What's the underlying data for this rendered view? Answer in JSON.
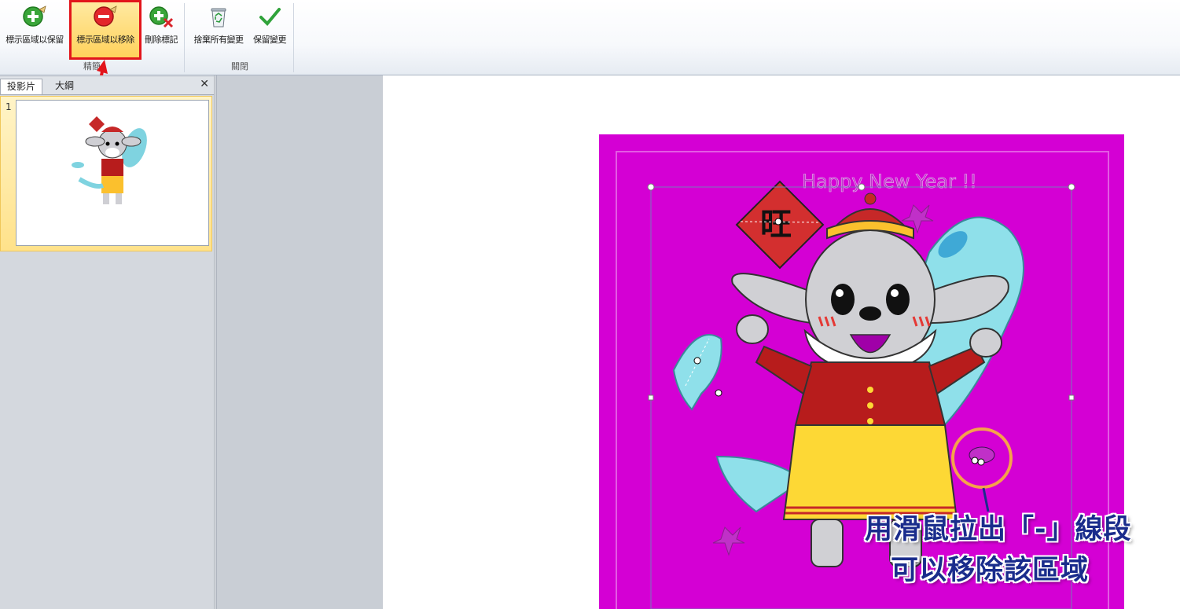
{
  "ribbon": {
    "refine_group": {
      "label": "精簡",
      "buttons": [
        {
          "label": "標示區域以保留",
          "icon": "add-mark-icon"
        },
        {
          "label": "標示區域以移除",
          "icon": "remove-mark-icon"
        },
        {
          "label": "刪除標記",
          "icon": "delete-mark-icon"
        }
      ]
    },
    "close_group": {
      "label": "關閉",
      "buttons": [
        {
          "label": "捨棄所有變更",
          "icon": "recycle-bin-icon"
        },
        {
          "label": "保留變更",
          "icon": "checkmark-icon"
        }
      ]
    }
  },
  "left_pane": {
    "tabs": [
      "投影片",
      "大綱"
    ],
    "close_icon": "close-icon",
    "slides": [
      {
        "number": "1"
      }
    ]
  },
  "picture": {
    "banner_text": "Happy New Year !!",
    "fu_character": "旺",
    "background_color": "#d400d4"
  },
  "annotation": {
    "line1": "用滑鼠拉出「-」線段",
    "line2": "可以移除該區域",
    "arrow_color": "#e2141b",
    "circle_color": "#f5a24b"
  }
}
